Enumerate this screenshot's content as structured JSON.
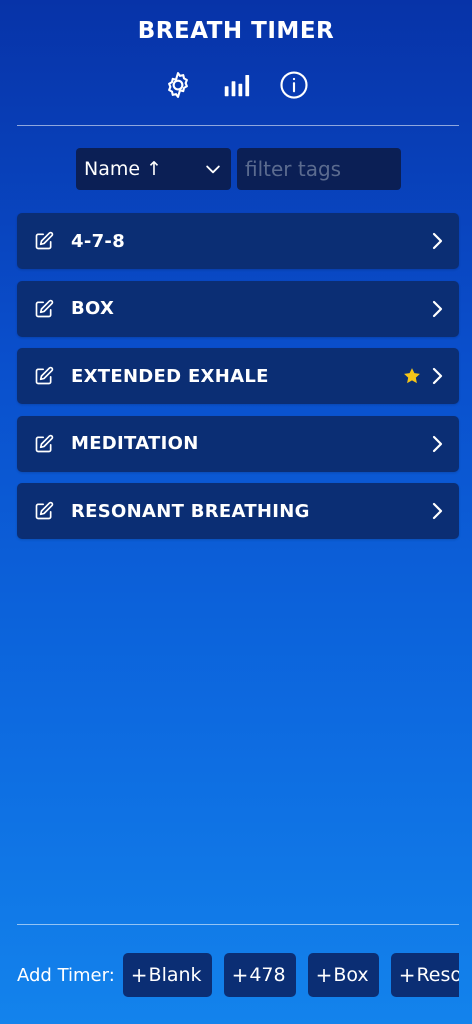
{
  "app": {
    "title": "BREATH TIMER"
  },
  "toolbar": {
    "icons": [
      "gear-icon",
      "bar-chart-icon",
      "info-icon"
    ]
  },
  "controls": {
    "sort_label": "Name ↑",
    "filter_placeholder": "filter tags"
  },
  "timers": [
    {
      "name": "4-7-8",
      "favorite": false
    },
    {
      "name": "BOX",
      "favorite": false
    },
    {
      "name": "EXTENDED EXHALE",
      "favorite": true
    },
    {
      "name": "MEDITATION",
      "favorite": false
    },
    {
      "name": "RESONANT BREATHING",
      "favorite": false
    }
  ],
  "add_timer": {
    "label": "Add Timer:",
    "plus": "+",
    "buttons": [
      "Blank",
      "478",
      "Box",
      "Resonant"
    ]
  },
  "colors": {
    "star": "#f5c518",
    "row_bg": "#0b2e74",
    "control_bg": "#0b1f55"
  }
}
